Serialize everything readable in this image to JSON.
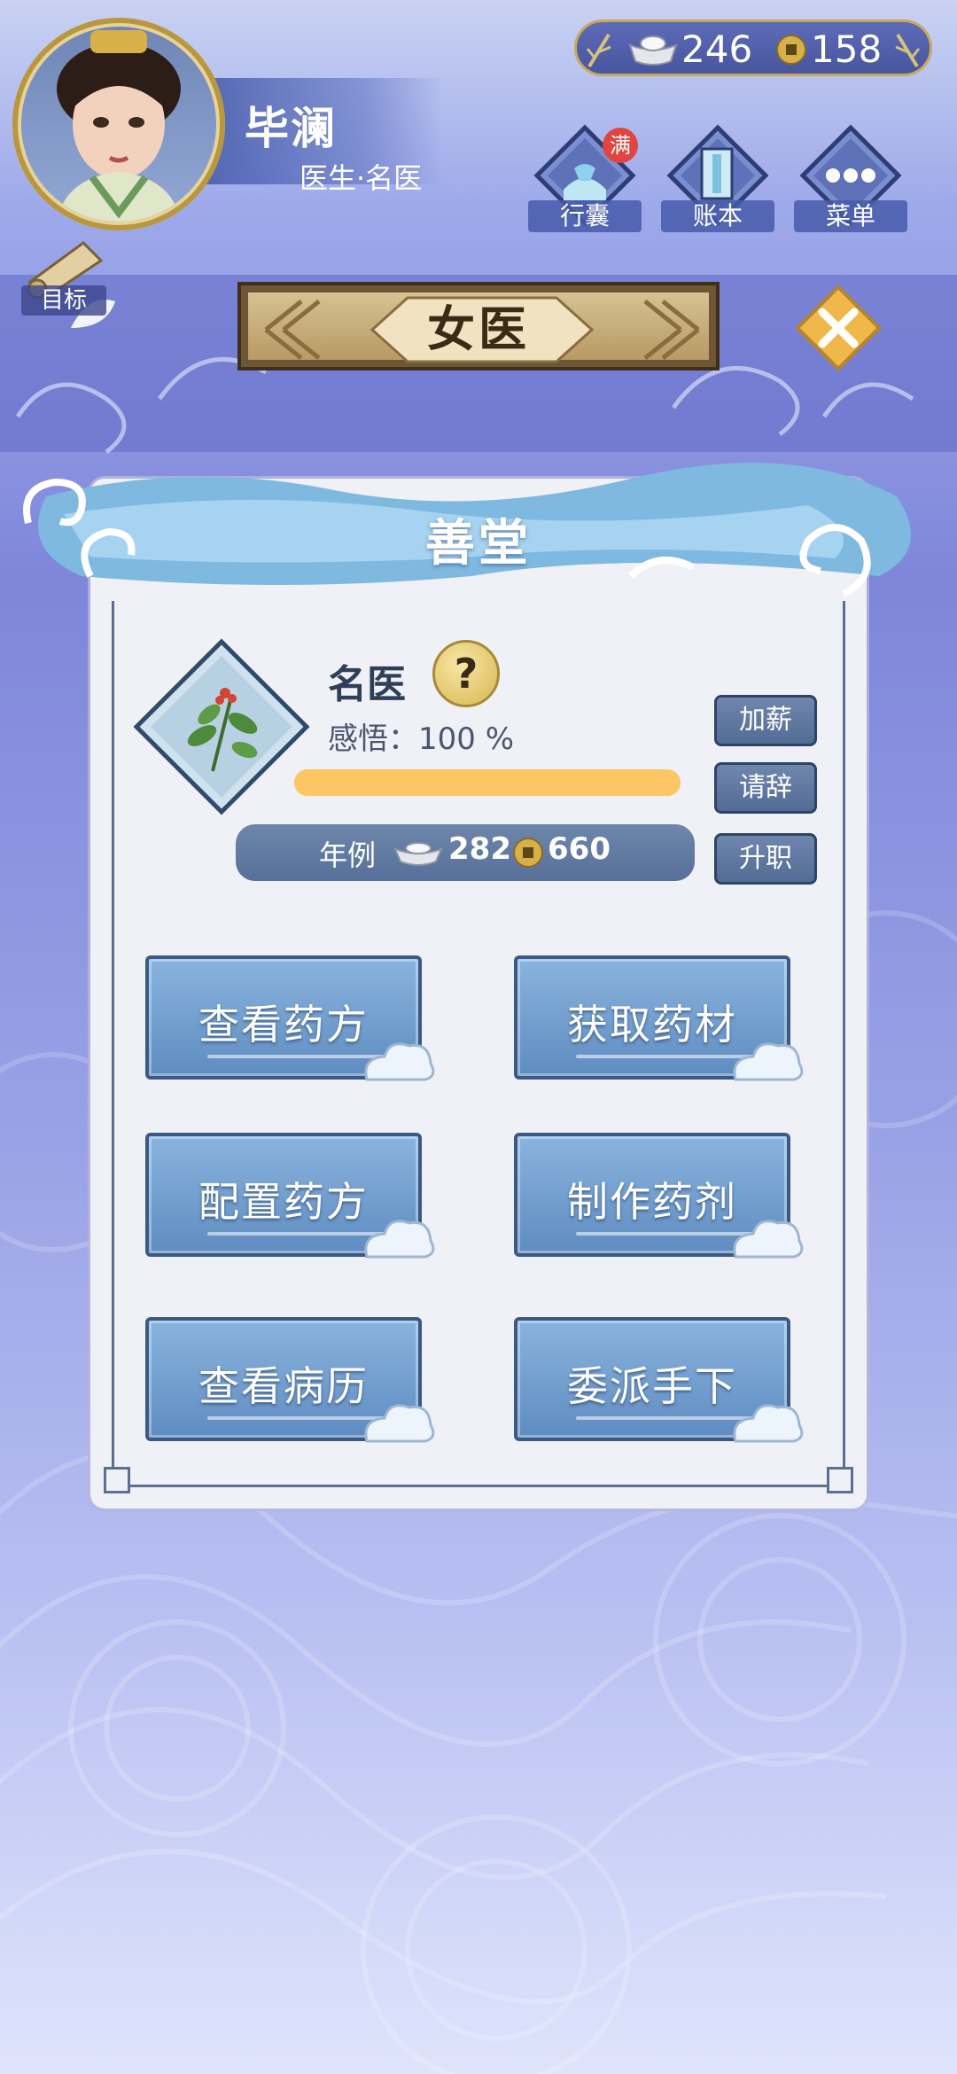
{
  "player": {
    "name": "毕澜",
    "title": "医生·名医"
  },
  "currency": {
    "silver": "246",
    "coins": "158"
  },
  "top_menu": [
    {
      "label": "行囊",
      "badge": "满"
    },
    {
      "label": "账本"
    },
    {
      "label": "菜单"
    }
  ],
  "goal": {
    "label": "目标"
  },
  "header": {
    "title": "女医"
  },
  "panel": {
    "title": "善堂",
    "rank": "名医",
    "help": "?",
    "insight": "感悟：100 %",
    "insight_progress": 1.0,
    "salary": {
      "label": "年例",
      "silver": "282",
      "coins": "660"
    },
    "side_buttons": [
      "加薪",
      "请辞",
      "升职"
    ],
    "actions": [
      "查看药方",
      "获取药材",
      "配置药方",
      "制作药剂",
      "查看病历",
      "委派手下"
    ]
  },
  "colors": {
    "accent_gold": "#fbc663",
    "panel_bg": "#f0f1f7",
    "button_blue": "#5f8cc0"
  }
}
